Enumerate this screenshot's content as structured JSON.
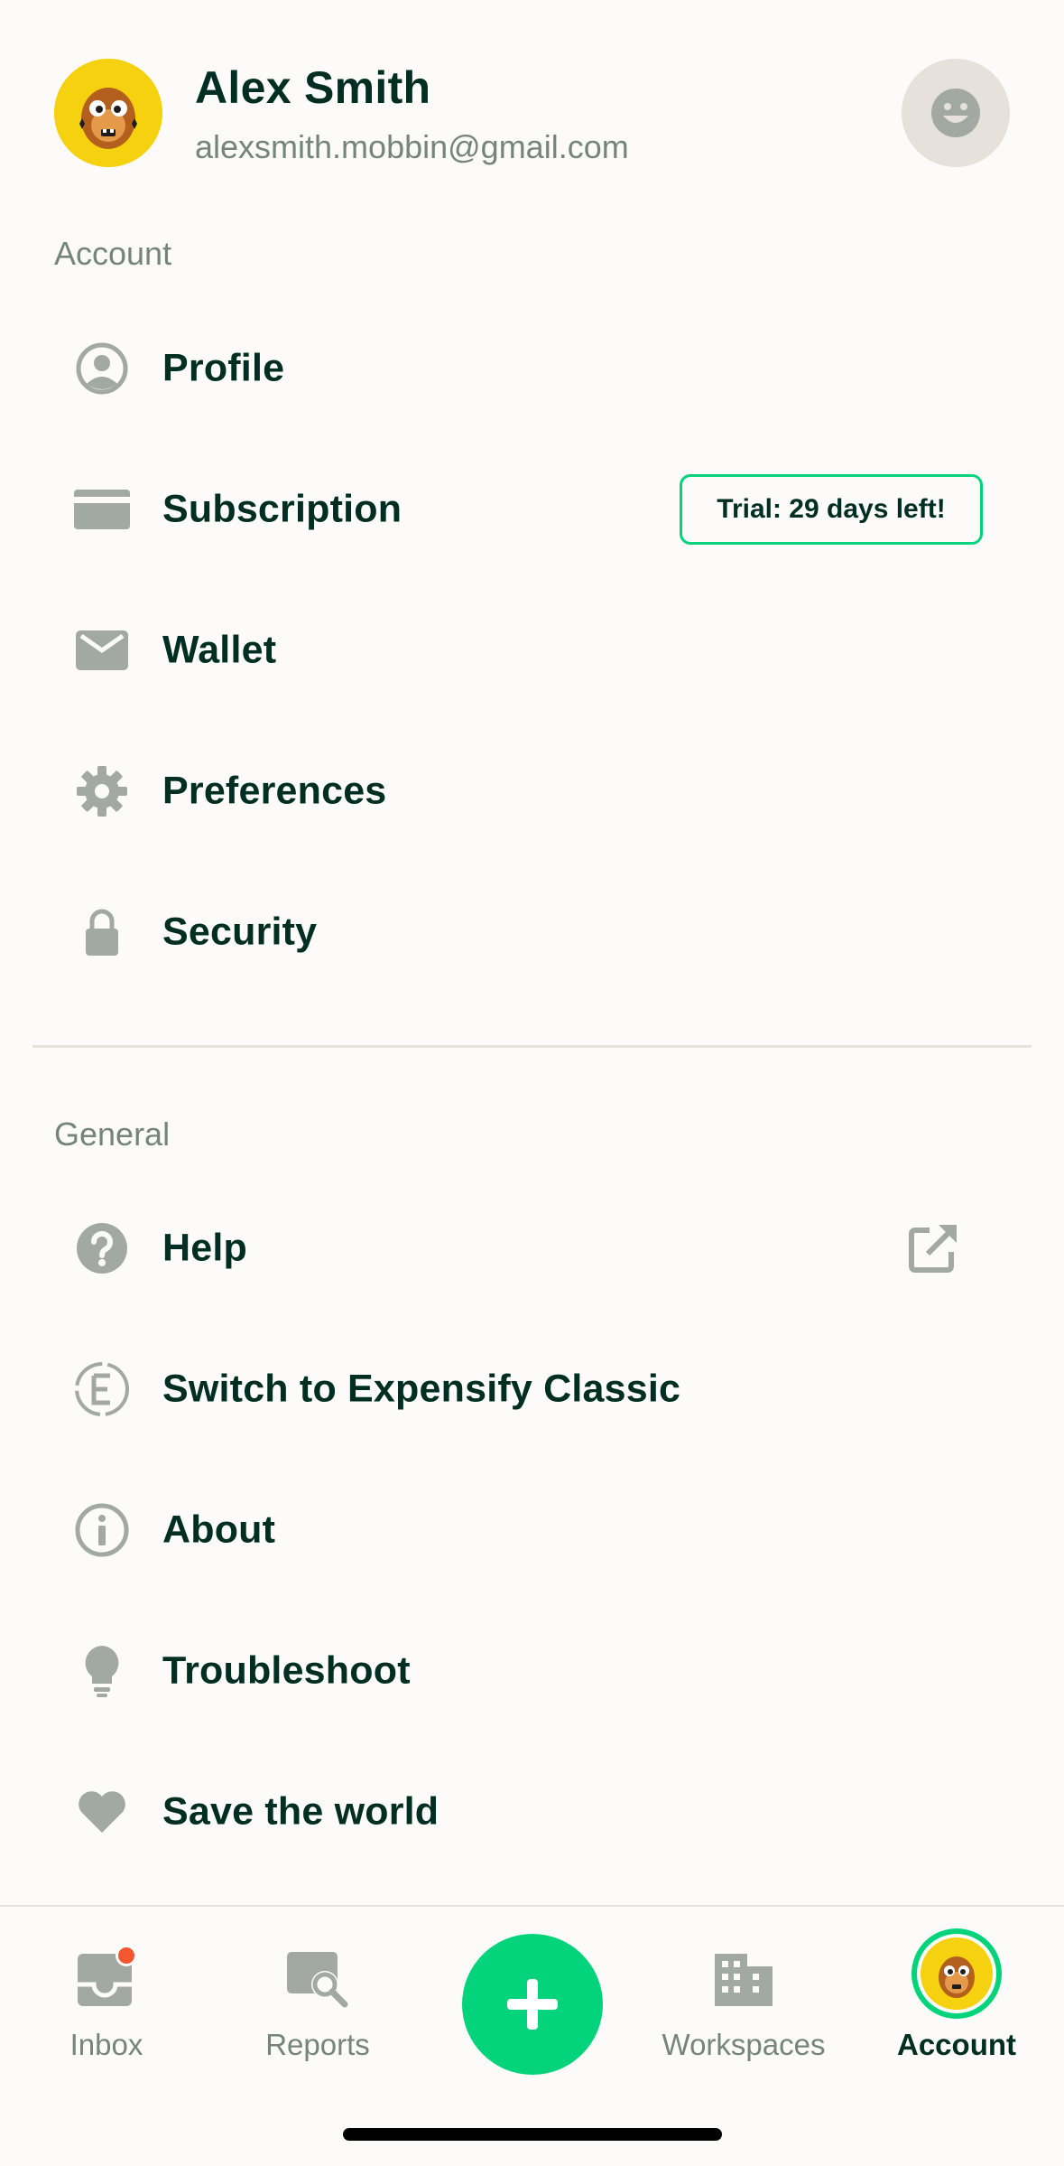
{
  "user": {
    "name": "Alex Smith",
    "email": "alexsmith.mobbin@gmail.com"
  },
  "account_section": {
    "label": "Account",
    "items": [
      {
        "label": "Profile",
        "icon": "profile-icon"
      },
      {
        "label": "Subscription",
        "icon": "card-icon",
        "badge": "Trial: 29 days left!"
      },
      {
        "label": "Wallet",
        "icon": "wallet-icon"
      },
      {
        "label": "Preferences",
        "icon": "gear-icon"
      },
      {
        "label": "Security",
        "icon": "lock-icon"
      }
    ]
  },
  "general_section": {
    "label": "General",
    "items": [
      {
        "label": "Help",
        "icon": "question-icon",
        "trailing_icon": "external-link-icon"
      },
      {
        "label": "Switch to Expensify Classic",
        "icon": "expensify-classic-icon"
      },
      {
        "label": "About",
        "icon": "info-icon"
      },
      {
        "label": "Troubleshoot",
        "icon": "lightbulb-icon"
      },
      {
        "label": "Save the world",
        "icon": "heart-icon"
      }
    ]
  },
  "tabbar": {
    "tabs": [
      {
        "label": "Inbox",
        "icon": "inbox-icon",
        "has_notification": true
      },
      {
        "label": "Reports",
        "icon": "reports-icon"
      },
      {
        "label": "Workspaces",
        "icon": "building-icon"
      },
      {
        "label": "Account",
        "icon": "avatar",
        "active": true
      }
    ],
    "fab_icon": "plus-icon"
  },
  "colors": {
    "accent": "#03d47c",
    "text": "#002e22",
    "muted": "#76847e",
    "icon": "#a2a9a3",
    "notification": "#f25730",
    "avatar_bg": "#f5d10f"
  }
}
